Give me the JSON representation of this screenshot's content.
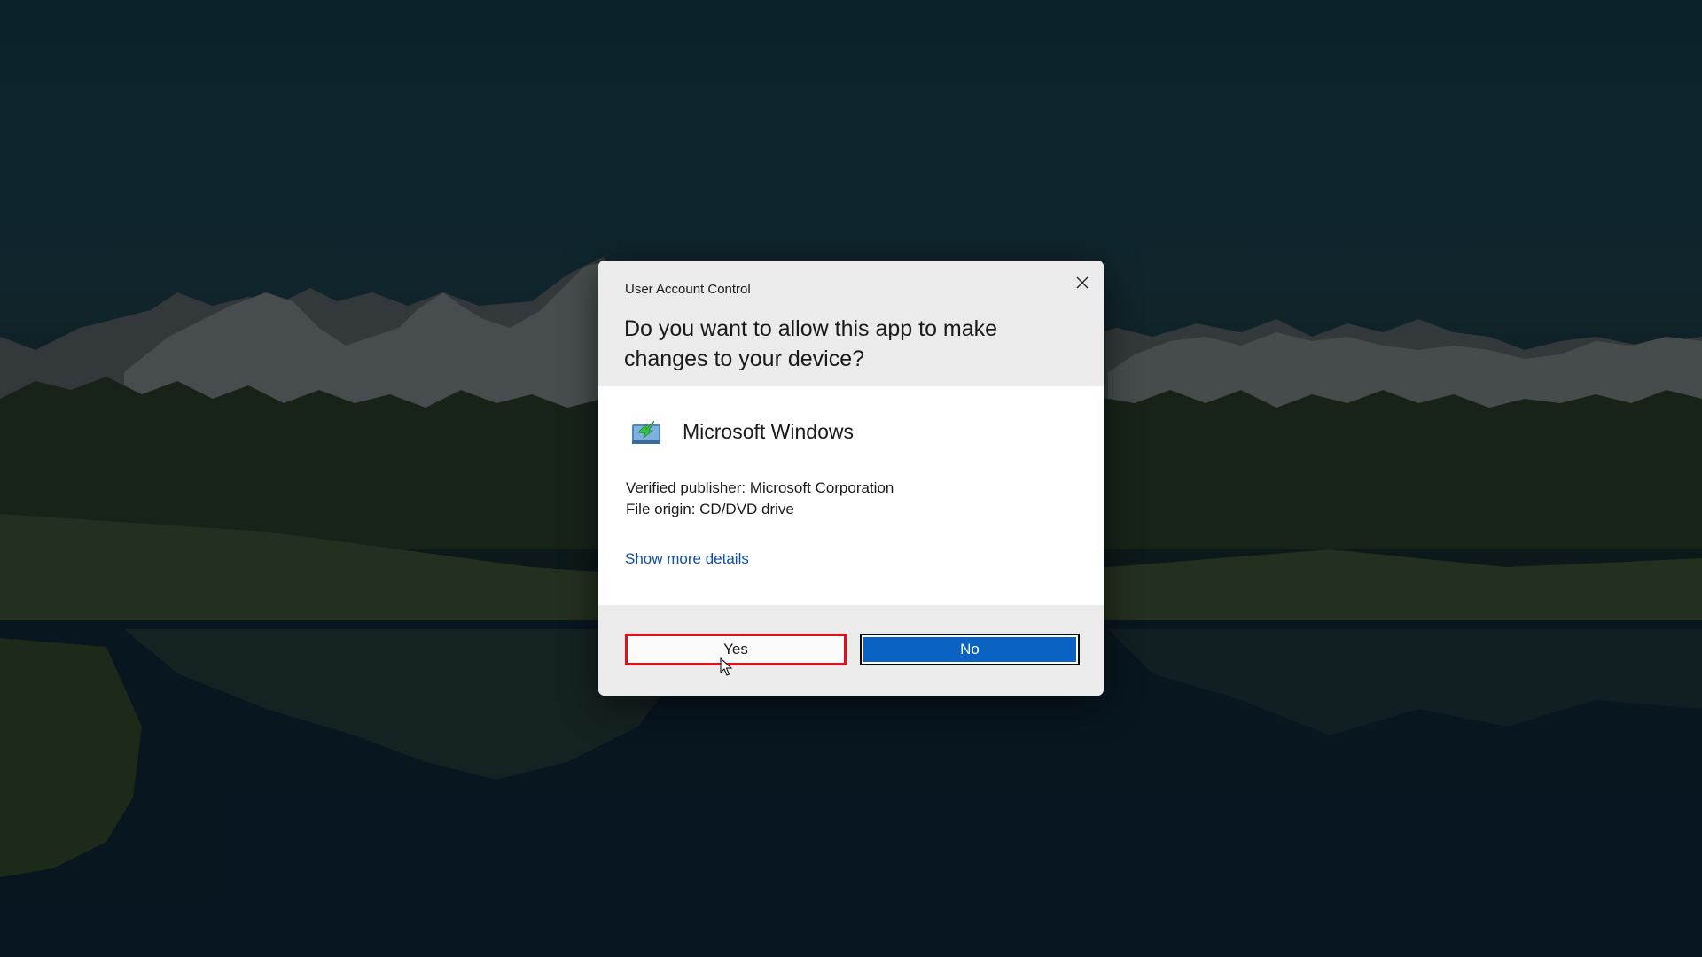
{
  "dialog": {
    "title": "User Account Control",
    "question": "Do you want to allow this app to make changes to your device?",
    "app_name": "Microsoft Windows",
    "app_icon": "windows-installer-icon",
    "publisher": "Verified publisher: Microsoft Corporation",
    "origin": "File origin: CD/DVD drive",
    "more_details": "Show more details",
    "yes_label": "Yes",
    "no_label": "No",
    "close_icon": "close-icon"
  },
  "colors": {
    "accent": "#0a63c2",
    "highlight": "#e0101a",
    "link": "#0f4fa0"
  }
}
